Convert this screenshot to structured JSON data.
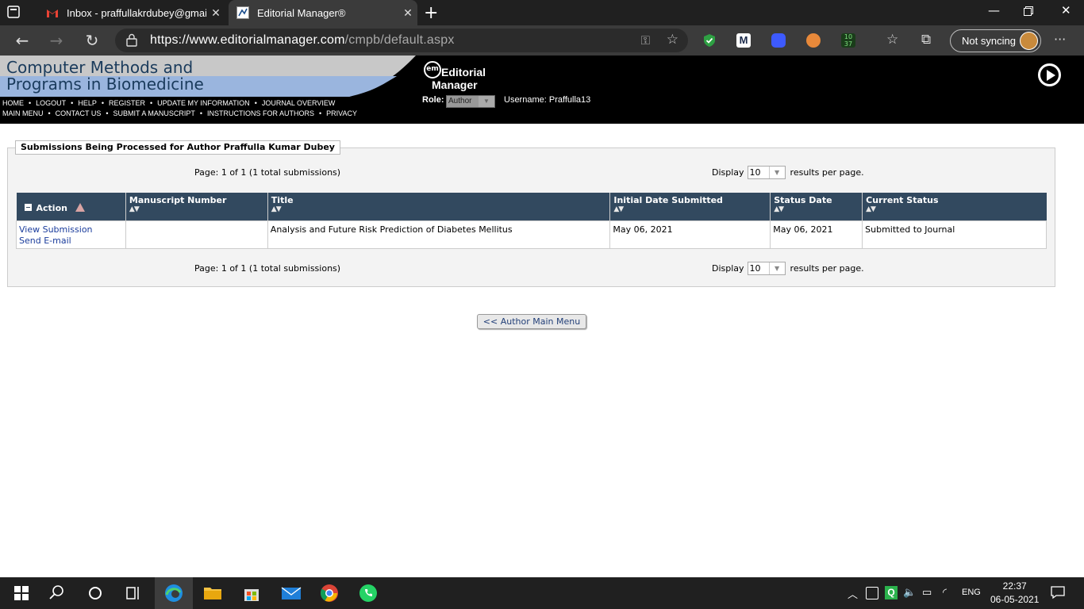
{
  "browser": {
    "tabs": [
      {
        "title": "Inbox - praffullakrdubey@gmail.c",
        "active": false
      },
      {
        "title": "Editorial Manager®",
        "active": true
      }
    ],
    "url_host": "https://www.editorialmanager.com",
    "url_path": "/cmpb/default.aspx",
    "sync_label": "Not syncing"
  },
  "journal": {
    "title_line1": "Computer Methods and",
    "title_line2": "Programs in Biomedicine",
    "logo_mark": "em",
    "logo_line1": "Editorial",
    "logo_line2": "Manager"
  },
  "topnav": {
    "row1": [
      "HOME",
      "LOGOUT",
      "HELP",
      "REGISTER",
      "UPDATE MY INFORMATION",
      "JOURNAL OVERVIEW"
    ],
    "row2": [
      "MAIN MENU",
      "CONTACT US",
      "SUBMIT A MANUSCRIPT",
      "INSTRUCTIONS FOR AUTHORS",
      "PRIVACY"
    ]
  },
  "user": {
    "role_label": "Role:",
    "role_value": "Author",
    "username_label": "Username: Praffulla13"
  },
  "submissions": {
    "heading": "Submissions Being Processed for Author Praffulla Kumar Dubey",
    "page_info": "Page: 1 of 1 (1 total submissions)",
    "display_label": "Display",
    "display_value": "10",
    "results_label": "results per page.",
    "columns": [
      "Action",
      "Manuscript Number",
      "Title",
      "Initial Date Submitted",
      "Status Date",
      "Current Status"
    ],
    "sort_glyph": "▲▼",
    "rows": [
      {
        "actions": [
          "View Submission",
          "Send E-mail"
        ],
        "manuscript_number": "",
        "title": "Analysis and Future Risk Prediction of Diabetes Mellitus",
        "initial_date": "May 06, 2021",
        "status_date": "May 06, 2021",
        "current_status": "Submitted to Journal"
      }
    ],
    "main_menu_button": "<< Author Main Menu"
  },
  "taskbar": {
    "lang": "ENG",
    "time": "22:37",
    "date": "06-05-2021"
  },
  "colors": {
    "header_bg": "#000000",
    "table_header": "#32495f",
    "link": "#1a3c9c",
    "browser_chrome": "#3b3b3b"
  }
}
